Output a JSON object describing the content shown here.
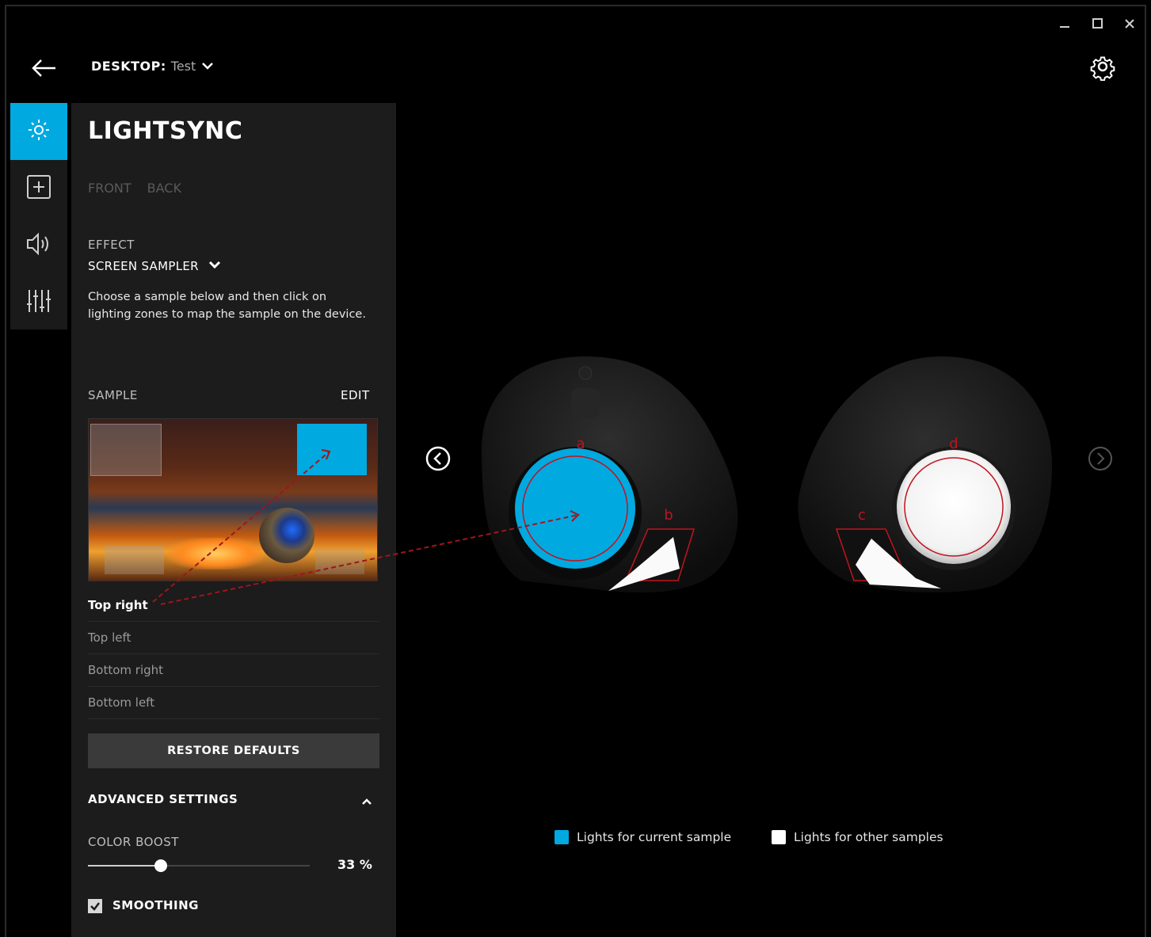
{
  "window": {
    "minimize_icon": "minimize-icon",
    "maximize_icon": "maximize-icon",
    "close_icon": "close-icon"
  },
  "header": {
    "profile_label": "DESKTOP:",
    "profile_value": "Test"
  },
  "rail": {
    "items": [
      "lightsync-icon",
      "assignments-icon",
      "audio-icon",
      "equalizer-icon"
    ],
    "active_index": 0
  },
  "panel": {
    "title": "LIGHTSYNC",
    "tabs": [
      "FRONT",
      "BACK"
    ],
    "effect_label": "EFFECT",
    "effect_value": "SCREEN SAMPLER",
    "description": "Choose a sample below and then click on lighting zones to map the sample on the device.",
    "sample_label": "SAMPLE",
    "edit_label": "EDIT",
    "samples": [
      "Top right",
      "Top left",
      "Bottom right",
      "Bottom left"
    ],
    "selected_sample_index": 0,
    "restore_label": "RESTORE DEFAULTS",
    "advanced_label": "ADVANCED SETTINGS",
    "color_boost_label": "COLOR BOOST",
    "color_boost_value": "33 %",
    "color_boost_fraction": 0.33,
    "smoothing_label": "SMOOTHING",
    "smoothing_checked": true
  },
  "device": {
    "zones": [
      "a",
      "b",
      "c",
      "d"
    ],
    "legend": {
      "current": "Lights for current sample",
      "other": "Lights for other samples"
    }
  },
  "colors": {
    "accent": "#00a9e0",
    "zone_outline": "#c0141e",
    "other_light": "#ffffff"
  }
}
